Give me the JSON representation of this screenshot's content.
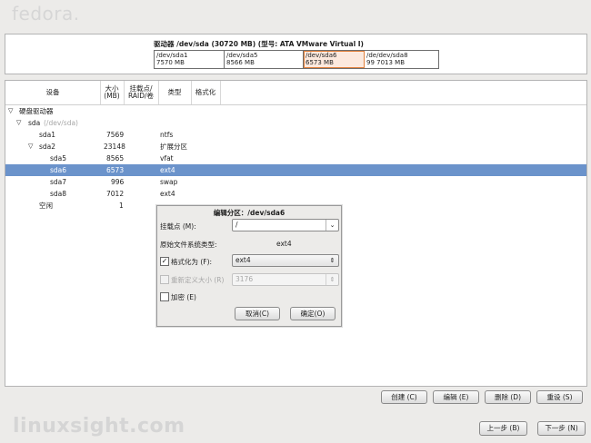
{
  "logo": "fedora.",
  "drive": {
    "title": "驱动器 /dev/sda (30720 MB) (型号: ATA VMware Virtual I)",
    "segments": [
      {
        "name": "/dev/sda1",
        "size": "7570 MB"
      },
      {
        "name": "/dev/sda5",
        "size": "8566 MB"
      },
      {
        "name": "/dev/sda6",
        "size": "6573 MB"
      },
      {
        "name": "/de/dev/sda8",
        "size": "99 7013 MB"
      }
    ]
  },
  "columns": {
    "device": "设备",
    "size": "大小\n(MB)",
    "mount": "挂载点/\nRAID/卷",
    "type": "类型",
    "format": "格式化"
  },
  "tree": {
    "root": "硬盘驱动器",
    "rows": [
      {
        "name": "sda",
        "sub": "(/dev/sda)",
        "size": "",
        "type": ""
      },
      {
        "name": "sda1",
        "size": "7569",
        "type": "ntfs"
      },
      {
        "name": "sda2",
        "size": "23148",
        "type": "扩展分区"
      },
      {
        "name": "sda5",
        "size": "8565",
        "type": "vfat"
      },
      {
        "name": "sda6",
        "size": "6573",
        "type": "ext4"
      },
      {
        "name": "sda7",
        "size": "996",
        "type": "swap"
      },
      {
        "name": "sda8",
        "size": "7012",
        "type": "ext4"
      },
      {
        "name": "空闲",
        "size": "1",
        "type": ""
      }
    ]
  },
  "dialog": {
    "title": "编辑分区：/dev/sda6",
    "mount_label": "挂载点 (M):",
    "mount_value": "/",
    "orig_fs_label": "原始文件系统类型:",
    "orig_fs_value": "ext4",
    "format_label": "格式化为 (F):",
    "format_value": "ext4",
    "resize_label": "重新定义大小 (R)",
    "resize_value": "3176",
    "encrypt_label": "加密 (E)",
    "cancel": "取消(C)",
    "ok": "确定(O)"
  },
  "actions": {
    "create": "创建 (C)",
    "edit": "编辑 (E)",
    "delete": "删除 (D)",
    "reset": "重设 (S)"
  },
  "nav": {
    "back": "上一步 (B)",
    "next": "下一步 (N)"
  },
  "watermark": "linuxsight.com"
}
